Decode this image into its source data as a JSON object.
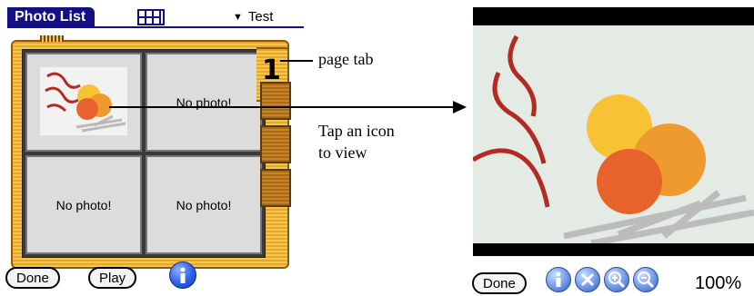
{
  "left_screen": {
    "title": "Photo List",
    "category": "Test",
    "page_number": "1",
    "cells": [
      {
        "label": "",
        "has_photo": true
      },
      {
        "label": "No photo!",
        "has_photo": false
      },
      {
        "label": "No photo!",
        "has_photo": false
      },
      {
        "label": "No photo!",
        "has_photo": false
      }
    ],
    "buttons": {
      "done": "Done",
      "play": "Play"
    }
  },
  "annotations": {
    "page_tab": "page tab",
    "tap_line1": "Tap an icon",
    "tap_line2": "to view"
  },
  "viewer": {
    "done": "Done",
    "zoom": "100%"
  },
  "colors": {
    "title_bar": "#141084",
    "frame_gold": "#f5c74b",
    "photo_red": "#b22a22",
    "photo_yellow": "#f7c234",
    "photo_orange": "#ef9a2f",
    "photo_orange_red": "#e8622b"
  }
}
